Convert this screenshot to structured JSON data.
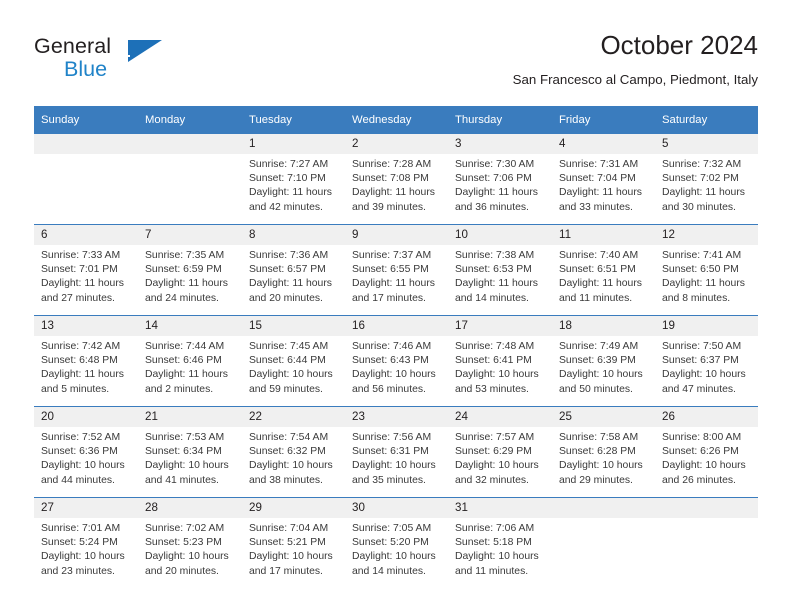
{
  "logo": {
    "word1": "General",
    "word2": "Blue",
    "triangle_color": "#1d70b8",
    "blue_text_color": "#2083c8"
  },
  "header": {
    "title": "October 2024",
    "subtitle": "San Francesco al Campo, Piedmont, Italy",
    "header_bg": "#3a7cbe",
    "daynum_bg": "#f0f0f0"
  },
  "calendar": {
    "weekday_headers": [
      "Sunday",
      "Monday",
      "Tuesday",
      "Wednesday",
      "Thursday",
      "Friday",
      "Saturday"
    ],
    "weeks": [
      [
        {
          "day": "",
          "blank": true
        },
        {
          "day": "",
          "blank": true
        },
        {
          "day": "1",
          "sunrise": "Sunrise: 7:27 AM",
          "sunset": "Sunset: 7:10 PM",
          "daylight": "Daylight: 11 hours and 42 minutes."
        },
        {
          "day": "2",
          "sunrise": "Sunrise: 7:28 AM",
          "sunset": "Sunset: 7:08 PM",
          "daylight": "Daylight: 11 hours and 39 minutes."
        },
        {
          "day": "3",
          "sunrise": "Sunrise: 7:30 AM",
          "sunset": "Sunset: 7:06 PM",
          "daylight": "Daylight: 11 hours and 36 minutes."
        },
        {
          "day": "4",
          "sunrise": "Sunrise: 7:31 AM",
          "sunset": "Sunset: 7:04 PM",
          "daylight": "Daylight: 11 hours and 33 minutes."
        },
        {
          "day": "5",
          "sunrise": "Sunrise: 7:32 AM",
          "sunset": "Sunset: 7:02 PM",
          "daylight": "Daylight: 11 hours and 30 minutes."
        }
      ],
      [
        {
          "day": "6",
          "sunrise": "Sunrise: 7:33 AM",
          "sunset": "Sunset: 7:01 PM",
          "daylight": "Daylight: 11 hours and 27 minutes."
        },
        {
          "day": "7",
          "sunrise": "Sunrise: 7:35 AM",
          "sunset": "Sunset: 6:59 PM",
          "daylight": "Daylight: 11 hours and 24 minutes."
        },
        {
          "day": "8",
          "sunrise": "Sunrise: 7:36 AM",
          "sunset": "Sunset: 6:57 PM",
          "daylight": "Daylight: 11 hours and 20 minutes."
        },
        {
          "day": "9",
          "sunrise": "Sunrise: 7:37 AM",
          "sunset": "Sunset: 6:55 PM",
          "daylight": "Daylight: 11 hours and 17 minutes."
        },
        {
          "day": "10",
          "sunrise": "Sunrise: 7:38 AM",
          "sunset": "Sunset: 6:53 PM",
          "daylight": "Daylight: 11 hours and 14 minutes."
        },
        {
          "day": "11",
          "sunrise": "Sunrise: 7:40 AM",
          "sunset": "Sunset: 6:51 PM",
          "daylight": "Daylight: 11 hours and 11 minutes."
        },
        {
          "day": "12",
          "sunrise": "Sunrise: 7:41 AM",
          "sunset": "Sunset: 6:50 PM",
          "daylight": "Daylight: 11 hours and 8 minutes."
        }
      ],
      [
        {
          "day": "13",
          "sunrise": "Sunrise: 7:42 AM",
          "sunset": "Sunset: 6:48 PM",
          "daylight": "Daylight: 11 hours and 5 minutes."
        },
        {
          "day": "14",
          "sunrise": "Sunrise: 7:44 AM",
          "sunset": "Sunset: 6:46 PM",
          "daylight": "Daylight: 11 hours and 2 minutes."
        },
        {
          "day": "15",
          "sunrise": "Sunrise: 7:45 AM",
          "sunset": "Sunset: 6:44 PM",
          "daylight": "Daylight: 10 hours and 59 minutes."
        },
        {
          "day": "16",
          "sunrise": "Sunrise: 7:46 AM",
          "sunset": "Sunset: 6:43 PM",
          "daylight": "Daylight: 10 hours and 56 minutes."
        },
        {
          "day": "17",
          "sunrise": "Sunrise: 7:48 AM",
          "sunset": "Sunset: 6:41 PM",
          "daylight": "Daylight: 10 hours and 53 minutes."
        },
        {
          "day": "18",
          "sunrise": "Sunrise: 7:49 AM",
          "sunset": "Sunset: 6:39 PM",
          "daylight": "Daylight: 10 hours and 50 minutes."
        },
        {
          "day": "19",
          "sunrise": "Sunrise: 7:50 AM",
          "sunset": "Sunset: 6:37 PM",
          "daylight": "Daylight: 10 hours and 47 minutes."
        }
      ],
      [
        {
          "day": "20",
          "sunrise": "Sunrise: 7:52 AM",
          "sunset": "Sunset: 6:36 PM",
          "daylight": "Daylight: 10 hours and 44 minutes."
        },
        {
          "day": "21",
          "sunrise": "Sunrise: 7:53 AM",
          "sunset": "Sunset: 6:34 PM",
          "daylight": "Daylight: 10 hours and 41 minutes."
        },
        {
          "day": "22",
          "sunrise": "Sunrise: 7:54 AM",
          "sunset": "Sunset: 6:32 PM",
          "daylight": "Daylight: 10 hours and 38 minutes."
        },
        {
          "day": "23",
          "sunrise": "Sunrise: 7:56 AM",
          "sunset": "Sunset: 6:31 PM",
          "daylight": "Daylight: 10 hours and 35 minutes."
        },
        {
          "day": "24",
          "sunrise": "Sunrise: 7:57 AM",
          "sunset": "Sunset: 6:29 PM",
          "daylight": "Daylight: 10 hours and 32 minutes."
        },
        {
          "day": "25",
          "sunrise": "Sunrise: 7:58 AM",
          "sunset": "Sunset: 6:28 PM",
          "daylight": "Daylight: 10 hours and 29 minutes."
        },
        {
          "day": "26",
          "sunrise": "Sunrise: 8:00 AM",
          "sunset": "Sunset: 6:26 PM",
          "daylight": "Daylight: 10 hours and 26 minutes."
        }
      ],
      [
        {
          "day": "27",
          "sunrise": "Sunrise: 7:01 AM",
          "sunset": "Sunset: 5:24 PM",
          "daylight": "Daylight: 10 hours and 23 minutes."
        },
        {
          "day": "28",
          "sunrise": "Sunrise: 7:02 AM",
          "sunset": "Sunset: 5:23 PM",
          "daylight": "Daylight: 10 hours and 20 minutes."
        },
        {
          "day": "29",
          "sunrise": "Sunrise: 7:04 AM",
          "sunset": "Sunset: 5:21 PM",
          "daylight": "Daylight: 10 hours and 17 minutes."
        },
        {
          "day": "30",
          "sunrise": "Sunrise: 7:05 AM",
          "sunset": "Sunset: 5:20 PM",
          "daylight": "Daylight: 10 hours and 14 minutes."
        },
        {
          "day": "31",
          "sunrise": "Sunrise: 7:06 AM",
          "sunset": "Sunset: 5:18 PM",
          "daylight": "Daylight: 10 hours and 11 minutes."
        },
        {
          "day": "",
          "blank": true
        },
        {
          "day": "",
          "blank": true
        }
      ]
    ]
  }
}
